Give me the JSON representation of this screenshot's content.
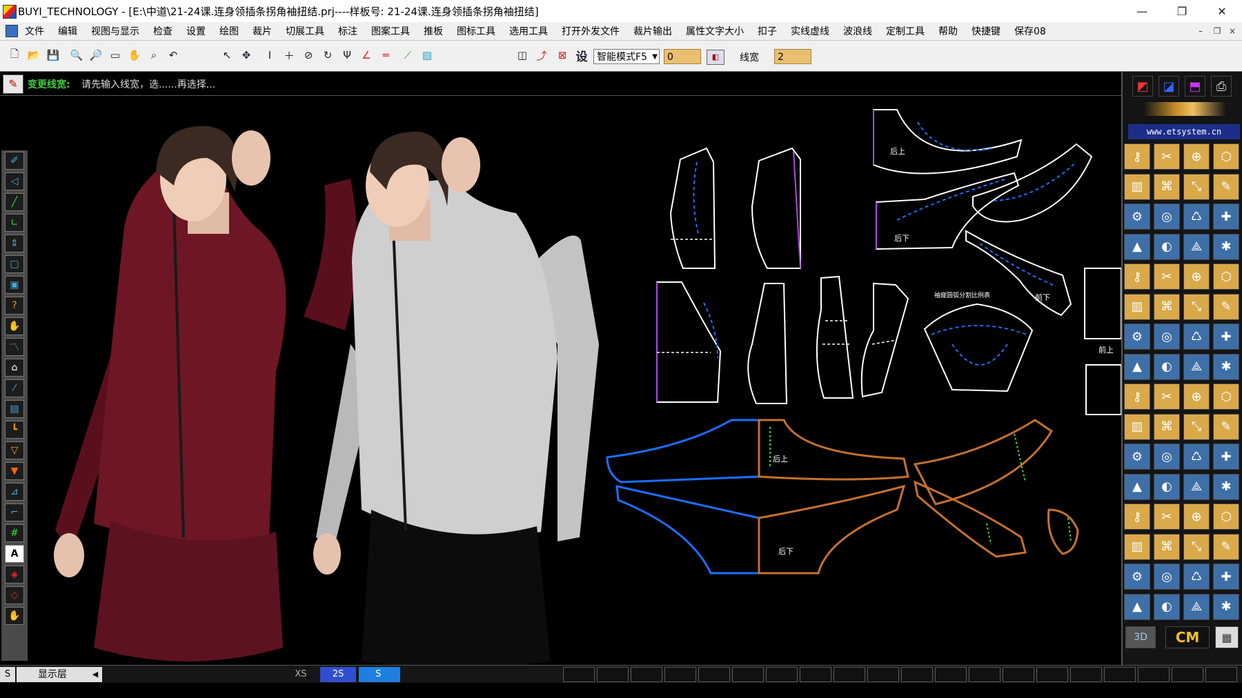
{
  "window": {
    "title": "BUYI_TECHNOLOGY - [E:\\中道\\21-24课.连身领插条拐角袖扭结.prj----样板号: 21-24课.连身领插条拐角袖扭结]",
    "minimize": "—",
    "restore": "❐",
    "close": "✕"
  },
  "menu": {
    "items": [
      "文件",
      "编辑",
      "视图与显示",
      "检查",
      "设置",
      "绘图",
      "裁片",
      "切展工具",
      "标注",
      "图案工具",
      "推板",
      "图标工具",
      "选用工具",
      "打开外发文件",
      "裁片输出",
      "属性文字大小",
      "扣子",
      "实线虚线",
      "波浪线",
      "定制工具",
      "帮助",
      "快捷键",
      "保存08"
    ],
    "mdi_min": "–",
    "mdi_restore": "❐",
    "mdi_close": "×"
  },
  "toolbar": {
    "settings_label": "设",
    "mode_value": "智能模式F5",
    "field1_value": "0",
    "linewidth_label": "线宽",
    "linewidth_value": "2"
  },
  "prompt": {
    "label": "变更线宽:",
    "text": "请先输入线宽，选......再选择..."
  },
  "right_panel": {
    "site": "www.etsystem.cn",
    "btn_3d": "3D",
    "btn_cm": "CM"
  },
  "bottom_bar": {
    "s_label": "S",
    "layer_label": "显示层",
    "size_xs": "XS",
    "size_2s": "2S",
    "size_s": "S"
  },
  "pattern_labels": {
    "back_upper": "后上",
    "back_lower": "后下",
    "front_upper": "前上",
    "front_lower": "前下",
    "sleeve_table": "袖窿圆弧分割比例表"
  },
  "colors": {
    "jacket_red": "#6e1624",
    "jacket_gray": "#c9c9c9",
    "skirt_black": "#0c0c0c",
    "pattern_line": "#ffffff",
    "seam_blue": "#1a6fff",
    "purple": "#b048e8",
    "orange": "#c8702a",
    "accent_green": "#3ed03e"
  }
}
